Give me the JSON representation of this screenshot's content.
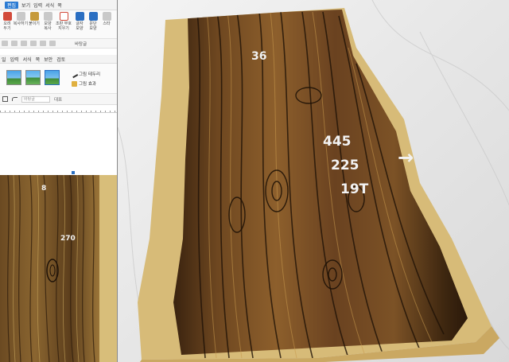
{
  "editor": {
    "menu": [
      "",
      "편집",
      "보기",
      "입력",
      "서식",
      "쪽",
      ""
    ],
    "ribbon_buttons": [
      {
        "label": "오려\n두기",
        "color": "#d24a3a"
      },
      {
        "label": "복사하기",
        "color": "#c9c9c9"
      },
      {
        "label": "붙이기",
        "color": "#c69a3a"
      },
      {
        "label": "모양\n복사",
        "color": "#c9c9c9"
      },
      {
        "label": "조판 부호\n지우기",
        "color": "#d24a3a"
      },
      {
        "label": "글자\n모양",
        "color": "#2b6fc2"
      },
      {
        "label": "문단\n모양",
        "color": "#2b6fc2"
      },
      {
        "label": "스타",
        "color": "#c9c9c9"
      }
    ],
    "quick_access_extra": "바탕글",
    "menu2": [
      "일",
      "입력",
      "서식",
      "쪽",
      "보안",
      "검토"
    ],
    "toolbar2": {
      "border_label": "그림 테두리",
      "effect_label": "그림 효과"
    },
    "style_field_placeholder": "바탕글",
    "font_field": "대표"
  },
  "left_photo": {
    "labels": [
      "8",
      "270"
    ]
  },
  "right_photo": {
    "labels": [
      "36",
      "445",
      "225",
      "19T"
    ],
    "arrow": "→"
  }
}
